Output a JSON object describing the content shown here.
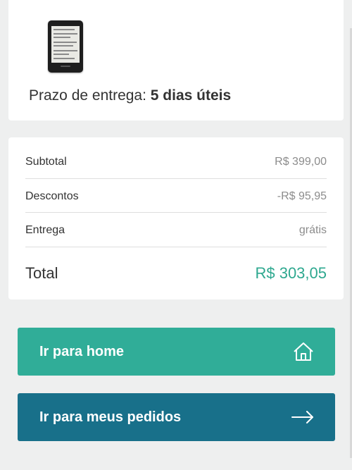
{
  "delivery": {
    "label": "Prazo de entrega:",
    "value": "5 dias úteis"
  },
  "summary": {
    "rows": [
      {
        "label": "Subtotal",
        "value": "R$ 399,00"
      },
      {
        "label": "Descontos",
        "value": "-R$ 95,95"
      },
      {
        "label": "Entrega",
        "value": "grátis"
      }
    ],
    "total": {
      "label": "Total",
      "value": "R$ 303,05"
    }
  },
  "actions": {
    "home_label": "Ir para home",
    "orders_label": "Ir para meus pedidos"
  },
  "colors": {
    "background": "#eeefef",
    "accent_green": "#30ad98",
    "accent_blue": "#18708a",
    "total_value": "#2ea88f"
  },
  "icons": {
    "home_button": "home-icon",
    "orders_button": "arrow-right-icon"
  }
}
